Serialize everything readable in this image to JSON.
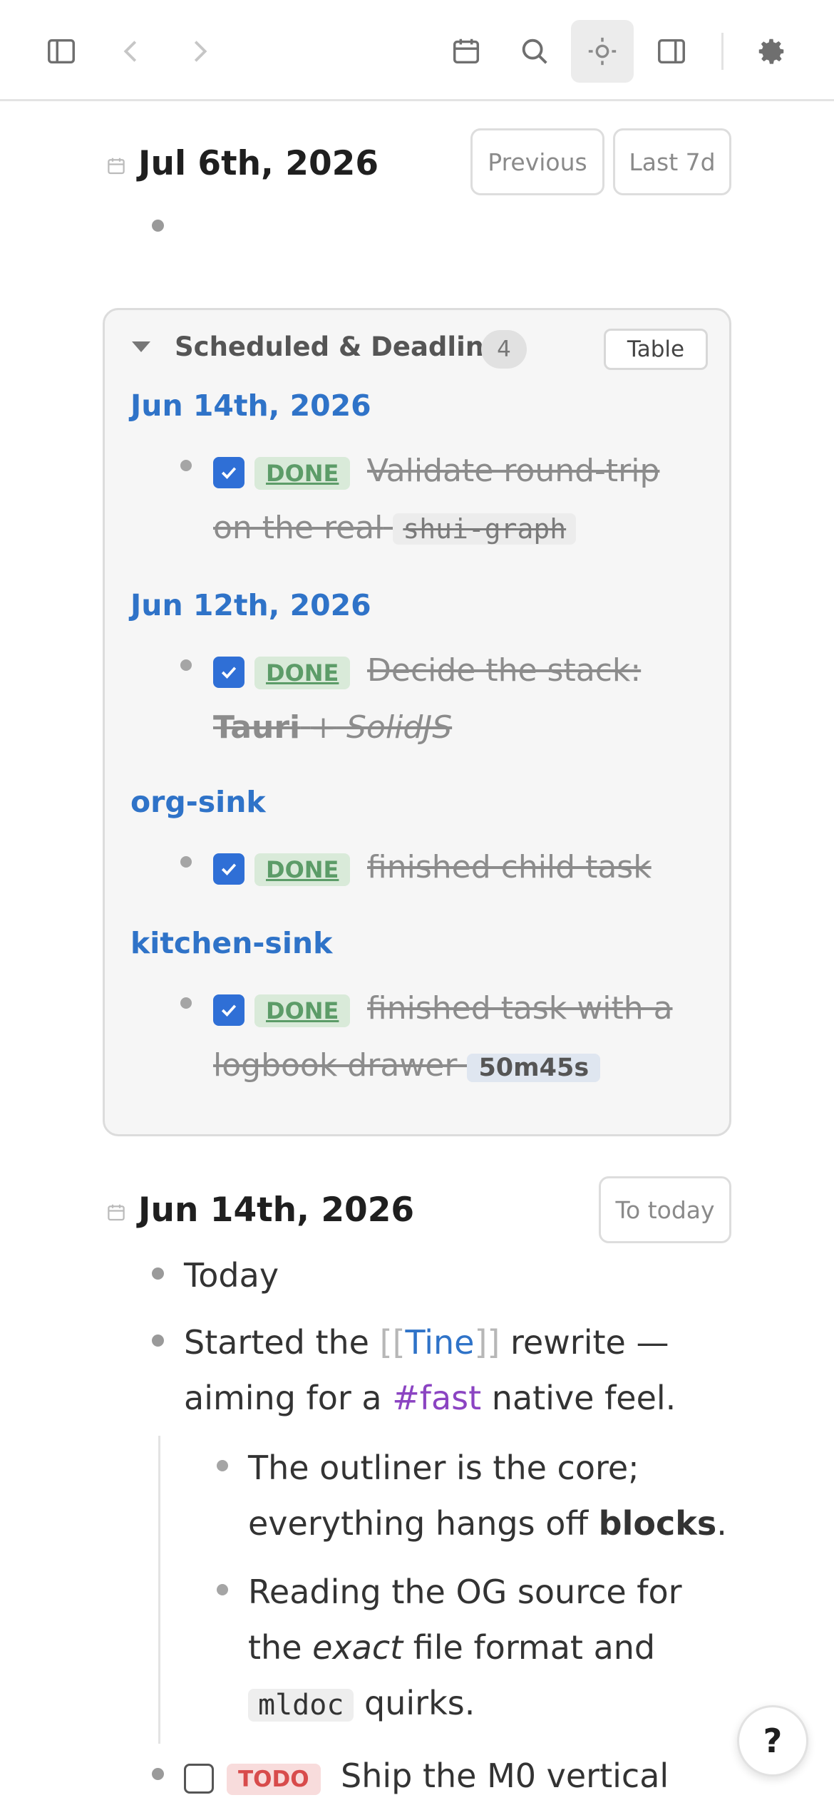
{
  "journal_1": {
    "title": "Jul 6th, 2026",
    "previous_label": "Previous",
    "last7_label": "Last 7d"
  },
  "scheduled": {
    "title": "Scheduled & Deadline",
    "count": "4",
    "view_label": "Table",
    "groups": [
      {
        "title": "Jun 14th, 2026",
        "badge": "DONE",
        "line1": "Validate round-trip",
        "line2": "on the real",
        "code": "shui-graph"
      },
      {
        "title": "Jun 12th, 2026",
        "badge": "DONE",
        "line1": "Decide the stack:",
        "bold": "Tauri",
        "plus": "+",
        "italic": "SolidJS"
      },
      {
        "title": "org-sink",
        "badge": "DONE",
        "line1": "finished child task"
      },
      {
        "title": "kitchen-sink",
        "badge": "DONE",
        "line1": "finished task with a",
        "line2": "logbook drawer",
        "time": "50m45s"
      }
    ]
  },
  "journal_2": {
    "title": "Jun 14th, 2026",
    "to_today_label": "To today",
    "blocks": {
      "today": "Today",
      "b2_pre": "Started the",
      "b2_bracket_open": "[[",
      "b2_link": "Tine",
      "b2_bracket_close": "]]",
      "b2_post": "rewrite —",
      "b2_l2_pre": "aiming for a",
      "b2_tag": "#fast",
      "b2_l2_post": "native feel.",
      "c1_l1": "The outliner is the core;",
      "c1_l2_pre": "everything hangs off",
      "c1_bold": "blocks",
      "c1_end": ".",
      "c2_l1": "Reading the OG source for",
      "c2_l2_pre": "the",
      "c2_italic": "exact",
      "c2_l2_post": "file format and",
      "c2_code": "mldoc",
      "c2_l3_post": "quirks.",
      "todo_badge": "TODO",
      "todo_text": "Ship the M0 vertical"
    }
  },
  "help_label": "?",
  "colors": {
    "accent_link": "#2f73c8",
    "checkbox": "#2f6fd6",
    "done_bg": "#d9ead9",
    "done_text": "#5c9c68",
    "todo_bg": "#f8dcdc",
    "todo_text": "#d84b4b",
    "tag": "#8b44c2"
  },
  "icons": [
    "sidebar-left-icon",
    "back-icon",
    "forward-icon",
    "calendar-icon",
    "search-icon",
    "sun-icon",
    "sidebar-right-icon",
    "gear-icon"
  ]
}
